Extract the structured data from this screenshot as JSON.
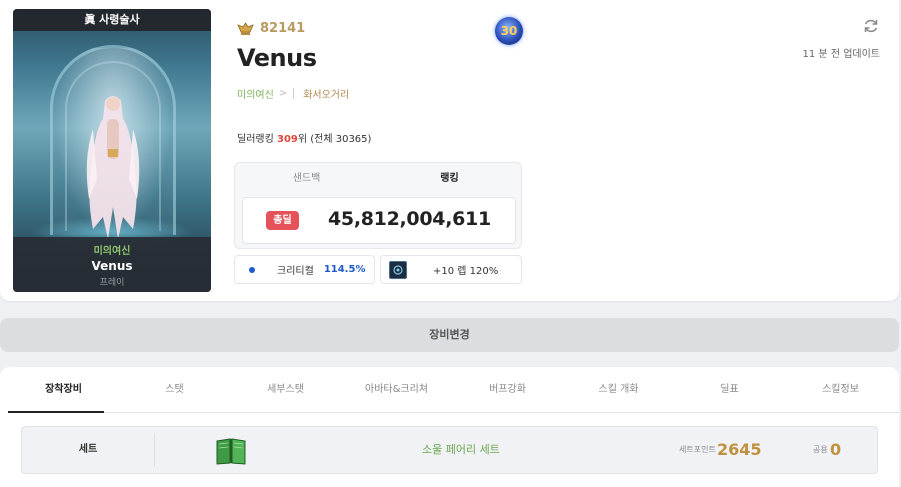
{
  "character": {
    "job_name": "眞 사령술사",
    "adventure_name": "미의여신",
    "name": "Venus",
    "server": "프레이",
    "fame": "82141",
    "level": "30",
    "guild": "화서오거리",
    "updated": "11 분 전 업데이트"
  },
  "ranking": {
    "prefix": "딜러랭킹 ",
    "rank": "309",
    "suffix": "위 (전체 30365)"
  },
  "damage_panel": {
    "tabs": [
      "샌드백",
      "랭킹"
    ],
    "active_tab": 1,
    "badge": "총딜",
    "total_damage": "45,812,004,611"
  },
  "stats": {
    "crit_label": "크리티컬",
    "crit_value": "114.5%",
    "weapon_refine": "+10 렙 120%"
  },
  "change_equipment_label": "장비변경",
  "nav": {
    "items": [
      "장착장비",
      "스탯",
      "세부스탯",
      "아바타&크리쳐",
      "버프강화",
      "스킬 개화",
      "딜표",
      "스킬정보"
    ],
    "active": 0
  },
  "set": {
    "label": "세트",
    "name": "소울 페어리 세트",
    "point_label": "세트포인트",
    "point_value": "2645",
    "common_label": "공용",
    "common_value": "0"
  },
  "colors": {
    "accent_green": "#7ab35a",
    "rank_red": "#e0463c",
    "crit_blue": "#1b5ac8",
    "gold": "#c0913f",
    "badge_red": "#e5525a"
  }
}
